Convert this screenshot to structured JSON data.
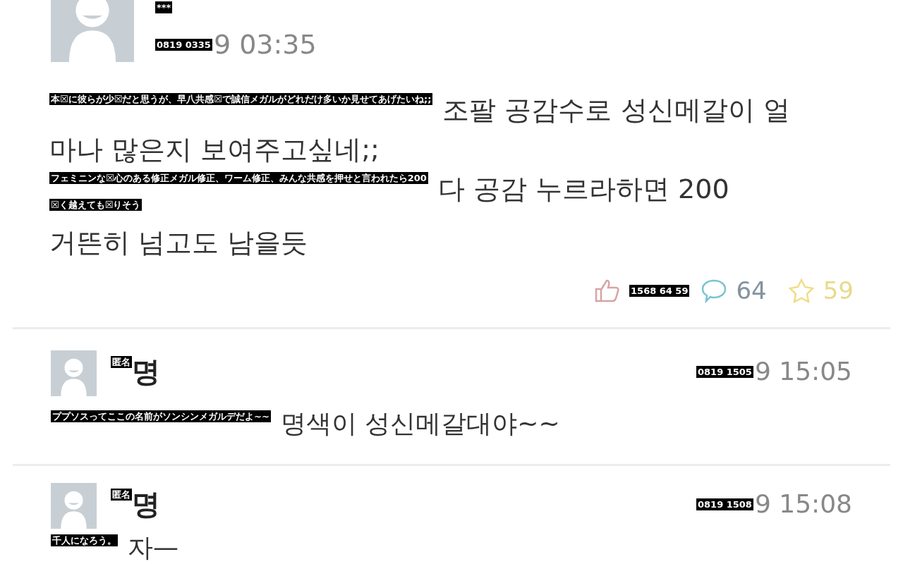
{
  "post": {
    "author_label": "***",
    "date_label": "0819 0335",
    "date": "9 03:35",
    "body": [
      {
        "label": "本☒に彼らが少☒だと思うが、早八共感☒で誠信メガルがどれだけ多いか見せてあげたいね;;",
        "text": "조팔 공감수로 성신메갈이 얼"
      },
      {
        "text": "마나 많은지 보여주고싶네;;"
      },
      {
        "label": "フェミニンな☒心のある修正メガル修正、ワーム修正、みんな共感を押せと言われたら200",
        "text": "다 공감 누르라하면 200"
      },
      {
        "label": "☒く越えても☒りそう"
      },
      {
        "text": "거뜬히 넘고도 남을듯"
      }
    ],
    "stats_label": "1568 64 59",
    "comment_count": "64",
    "favorite_count": "59"
  },
  "comments": [
    {
      "author_label": "匿名",
      "author": "명",
      "date_label": "0819 1505",
      "date": "9 15:05",
      "label": "ププソスってここの名前がソンシンメガルデだよ~~",
      "text": "명색이 성신메갈대야~~"
    },
    {
      "author_label": "匿名",
      "author": "명",
      "date_label": "0819 1508",
      "date": "9 15:08",
      "label": "千人になろう。",
      "text": "자—"
    }
  ]
}
